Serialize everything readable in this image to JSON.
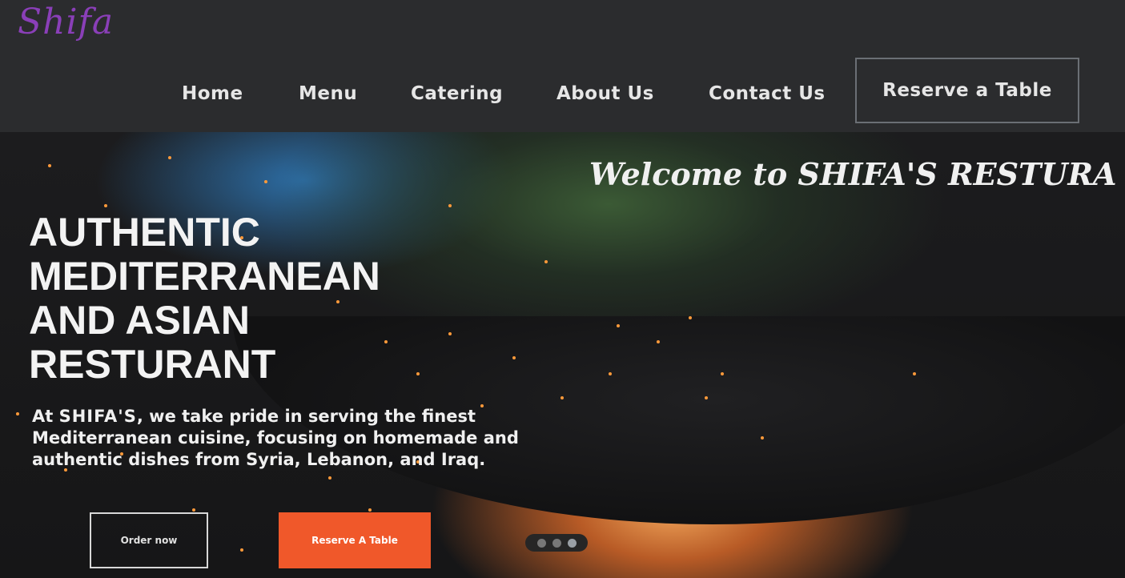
{
  "logo": {
    "text": "Shifa"
  },
  "nav": {
    "items": [
      "Home",
      "Menu",
      "Catering",
      "About Us",
      "Contact Us"
    ],
    "reserve_label": "Reserve a Table"
  },
  "hero": {
    "welcome": "Welcome to SHIFA'S RESTURA",
    "headline_lines": [
      "AUTHENTIC",
      "MEDITERRANEAN",
      "AND ASIAN",
      "RESTURANT"
    ],
    "intro_prefix": "At ",
    "intro_brand": "SHIFA'S",
    "intro_rest": ", we take pride in serving the finest Mediterranean cuisine, focusing on homemade and authentic dishes from Syria, Lebanon, and Iraq.",
    "order_button": "Order now",
    "reserve_button": "Reserve A Table",
    "carousel_dots": 3,
    "carousel_active": 2
  },
  "colors": {
    "accent": "#f0582a",
    "logo": "#8a3fb8",
    "header_bg": "#2b2c2e"
  }
}
